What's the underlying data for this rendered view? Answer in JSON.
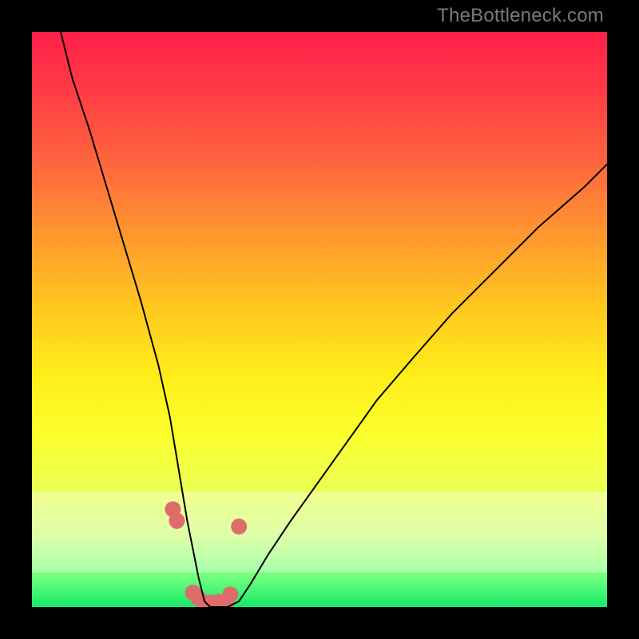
{
  "watermark": "TheBottleneck.com",
  "chart_data": {
    "type": "line",
    "title": "",
    "xlabel": "",
    "ylabel": "",
    "xlim": [
      0,
      100
    ],
    "ylim": [
      0,
      100
    ],
    "grid": false,
    "series": [
      {
        "name": "bottleneck-curve",
        "x": [
          5,
          7,
          10,
          13,
          16,
          19,
          22,
          24,
          25,
          26,
          27,
          28,
          29,
          30,
          31,
          32,
          33,
          34,
          36,
          38,
          41,
          45,
          50,
          55,
          60,
          66,
          73,
          80,
          88,
          96,
          100
        ],
        "values": [
          100,
          92,
          83,
          73,
          63,
          53,
          42,
          33,
          27,
          21,
          15,
          10,
          5,
          1,
          0,
          0,
          0,
          0,
          1,
          4,
          9,
          15,
          22,
          29,
          36,
          43,
          51,
          58,
          66,
          73,
          77
        ],
        "stroke": "#000000",
        "width": 2
      }
    ],
    "bottom_points": {
      "comment": "Highlighted sample points near the trough of the curve",
      "x": [
        24.5,
        25.2,
        28.0,
        29.0,
        30.0,
        31.0,
        32.5,
        33.8,
        34.5,
        36.0
      ],
      "values": [
        17,
        15,
        2.5,
        1.5,
        0.8,
        0.8,
        0.9,
        1.0,
        2.2,
        14
      ],
      "fill": "#e06b6b",
      "radius": 10
    },
    "green_zone_pct": [
      0,
      6
    ],
    "pale_zone_pct": [
      6,
      20
    ]
  }
}
